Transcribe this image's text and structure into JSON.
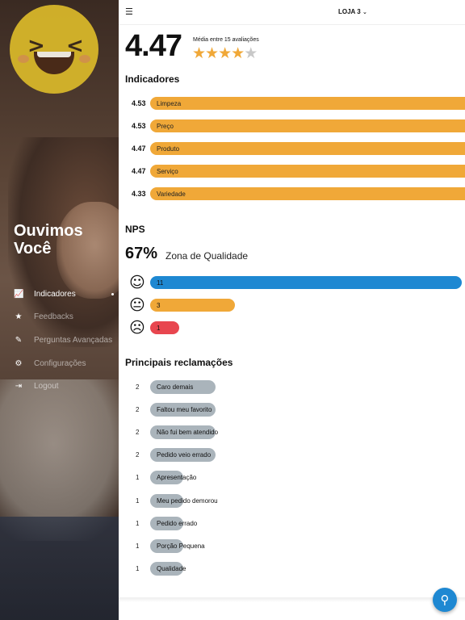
{
  "sidebar": {
    "brand_line1": "Ouvimos",
    "brand_line2": "Você",
    "items": [
      {
        "label": "Indicadores",
        "icon": "chart-icon",
        "glyph": "📈",
        "active": true
      },
      {
        "label": "Feedbacks",
        "icon": "star-icon",
        "glyph": "★",
        "active": false
      },
      {
        "label": "Perguntas Avançadas",
        "icon": "edit-icon",
        "glyph": "✎",
        "active": false
      },
      {
        "label": "Configurações",
        "icon": "gear-icon",
        "glyph": "⚙",
        "active": false
      },
      {
        "label": "Logout",
        "icon": "logout-icon",
        "glyph": "⇥",
        "active": false
      }
    ]
  },
  "topbar": {
    "menu_icon": "☰",
    "store_label": "LOJA 3",
    "chevron": "⌄"
  },
  "rating": {
    "score": "4.47",
    "average_text": "Média entre 15 avaliações",
    "stars_filled": 4,
    "stars_total": 5,
    "star_glyph": "★"
  },
  "indicators": {
    "title": "Indicadores",
    "items": [
      {
        "value": "4.53",
        "label": "Limpeza"
      },
      {
        "value": "4.53",
        "label": "Preço"
      },
      {
        "value": "4.47",
        "label": "Produto"
      },
      {
        "value": "4.47",
        "label": "Serviço"
      },
      {
        "value": "4.33",
        "label": "Variedade"
      }
    ]
  },
  "nps": {
    "title": "NPS",
    "percent": "67%",
    "zone": "Zona de Qualidade",
    "rows": [
      {
        "face": "☺",
        "count": "11",
        "color": "#1e88d2"
      },
      {
        "face": "😐",
        "count": "3",
        "color": "#f0a838"
      },
      {
        "face": "☹",
        "count": "1",
        "color": "#e8464f"
      }
    ]
  },
  "complaints": {
    "title": "Principais reclamações",
    "items": [
      {
        "count": "2",
        "label": "Caro demais"
      },
      {
        "count": "2",
        "label": "Faltou meu favorito"
      },
      {
        "count": "2",
        "label": "Não fui bem atendido"
      },
      {
        "count": "2",
        "label": "Pedido veio errado"
      },
      {
        "count": "1",
        "label": "Apresentação"
      },
      {
        "count": "1",
        "label": "Meu pedido demorou"
      },
      {
        "count": "1",
        "label": "Pedido errado"
      },
      {
        "count": "1",
        "label": "Porção Pequena"
      },
      {
        "count": "1",
        "label": "Qualidade"
      }
    ]
  },
  "fab": {
    "icon": "filter-icon",
    "glyph": "⚲"
  },
  "colors": {
    "accent_orange": "#f0a838",
    "accent_blue": "#1e88d2",
    "accent_red": "#e8464f",
    "complaint_gray": "#aab4bb"
  }
}
